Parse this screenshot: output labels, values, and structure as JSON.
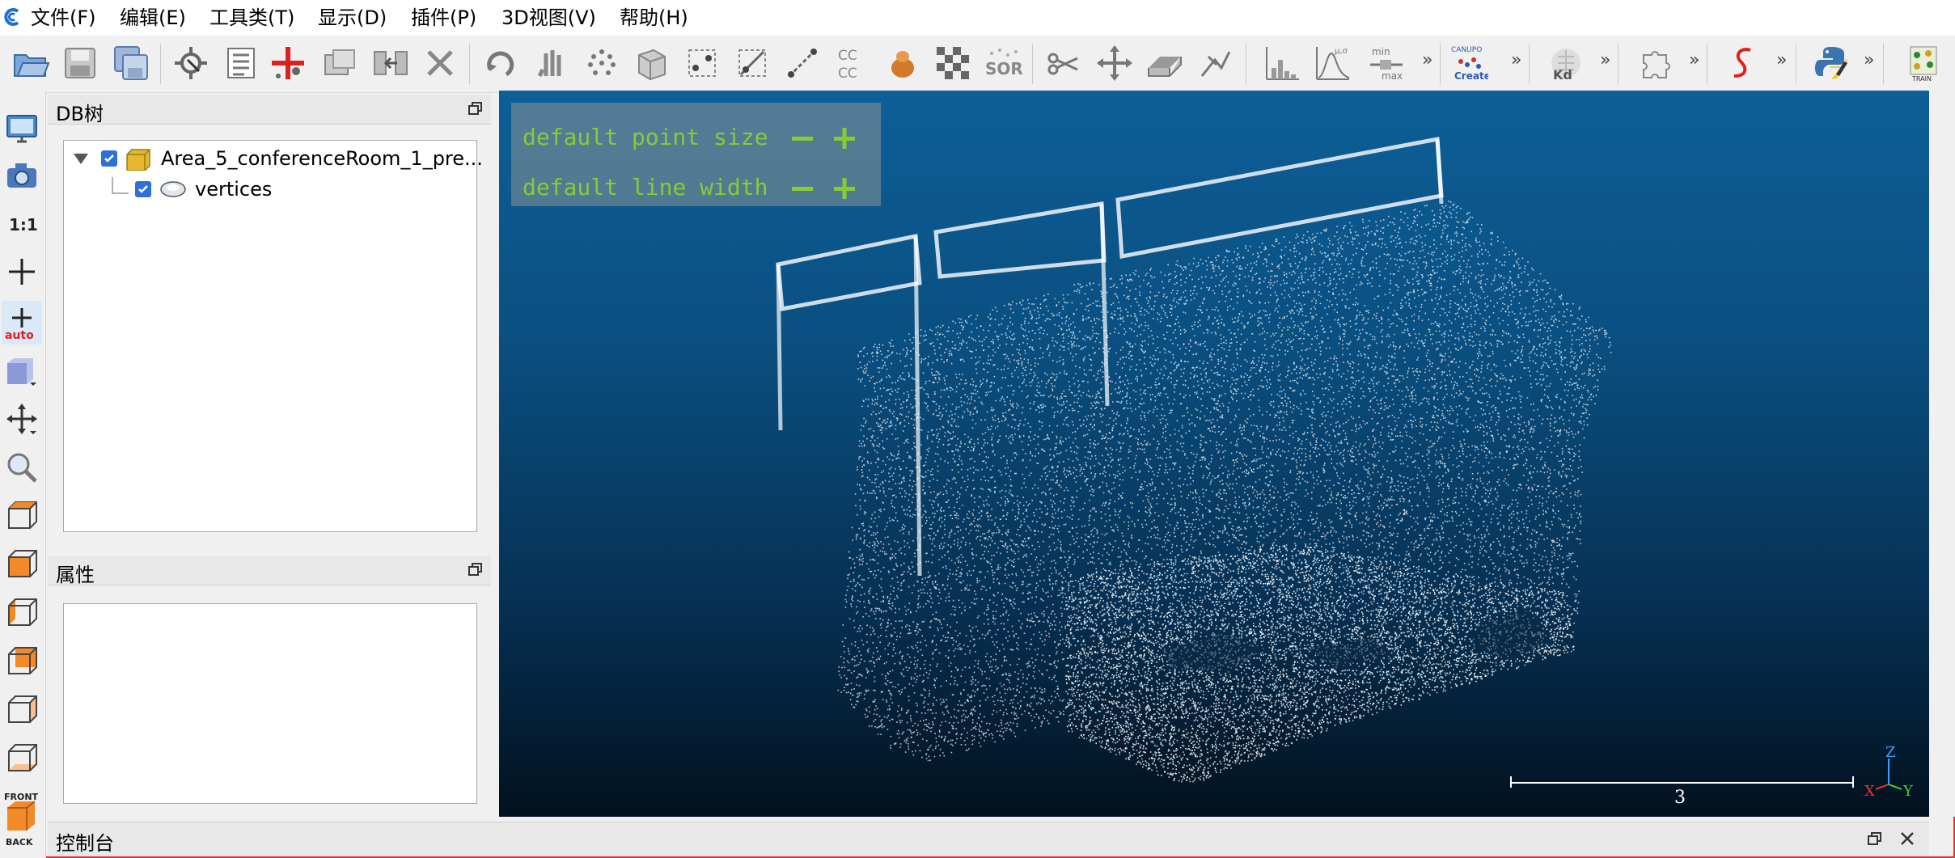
{
  "menu": {
    "items": [
      "文件(F)",
      "编辑(E)",
      "工具类(T)",
      "显示(D)",
      "插件(P)",
      "3D视图(V)",
      "帮助(H)"
    ]
  },
  "toolbar": {
    "texts": {
      "cc": "CC\nCC",
      "sor": "SOR",
      "musigma": "μ,σ",
      "minmax_a": "min",
      "minmax_b": "max",
      "canupo": "CANUPO",
      "create": "Create",
      "kd": "Kd",
      "train": "TRAIN",
      "more": "»"
    }
  },
  "leftcol": {
    "scale_label": "1:1",
    "auto_label": "auto",
    "front_label": "FRONT",
    "back_label": "BACK"
  },
  "db_tree": {
    "title": "DB树",
    "root_label": "Area_5_conferenceRoom_1_pre...",
    "child_label": "vertices"
  },
  "properties": {
    "title": "属性"
  },
  "viewport": {
    "point_size_label": "default point size",
    "line_width_label": "default line width",
    "minus": "−",
    "plus": "+",
    "scale_value": "3",
    "axis_x": "X",
    "axis_y": "Y",
    "axis_z": "Z"
  },
  "console": {
    "title": "控制台"
  },
  "colors": {
    "overlay_text": "#88cc33",
    "viewport_top": "#0d5f98",
    "viewport_bottom": "#02111e",
    "checkbox": "#2f6fd8"
  }
}
